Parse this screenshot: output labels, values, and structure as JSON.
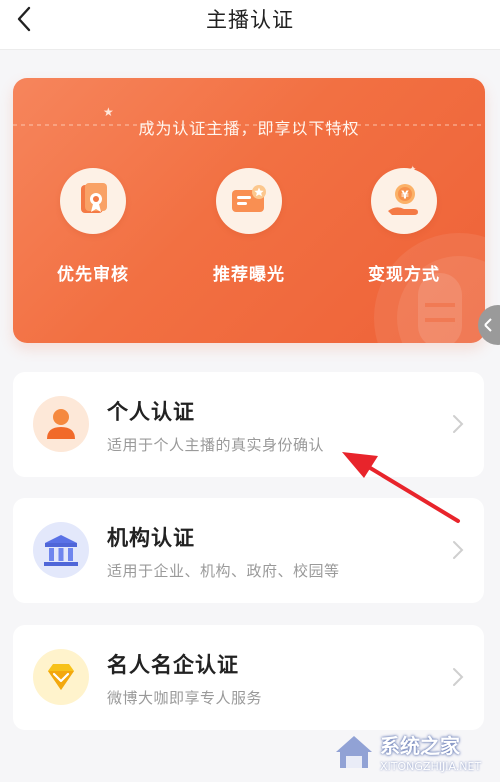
{
  "header": {
    "title": "主播认证",
    "back_icon": "chevron-left-icon"
  },
  "banner": {
    "subtitle": "成为认证主播，即享以下特权",
    "perks": [
      {
        "label": "优先审核",
        "icon": "certificate-icon"
      },
      {
        "label": "推荐曝光",
        "icon": "card-star-icon"
      },
      {
        "label": "变现方式",
        "icon": "coin-hand-icon"
      }
    ]
  },
  "cards": [
    {
      "title": "个人认证",
      "desc": "适用于个人主播的真实身份确认",
      "icon": "person-icon"
    },
    {
      "title": "机构认证",
      "desc": "适用于企业、机构、政府、校园等",
      "icon": "institution-icon"
    },
    {
      "title": "名人名企认证",
      "desc": "微博大咖即享专人服务",
      "icon": "diamond-icon"
    }
  ],
  "watermark": {
    "text": "系统之家",
    "url": "XITONGZHIJIA.NET"
  },
  "colors": {
    "banner": "#f27042",
    "card_title": "#222222",
    "card_desc": "#9a9a9a",
    "annotation_arrow": "#e8242b"
  }
}
